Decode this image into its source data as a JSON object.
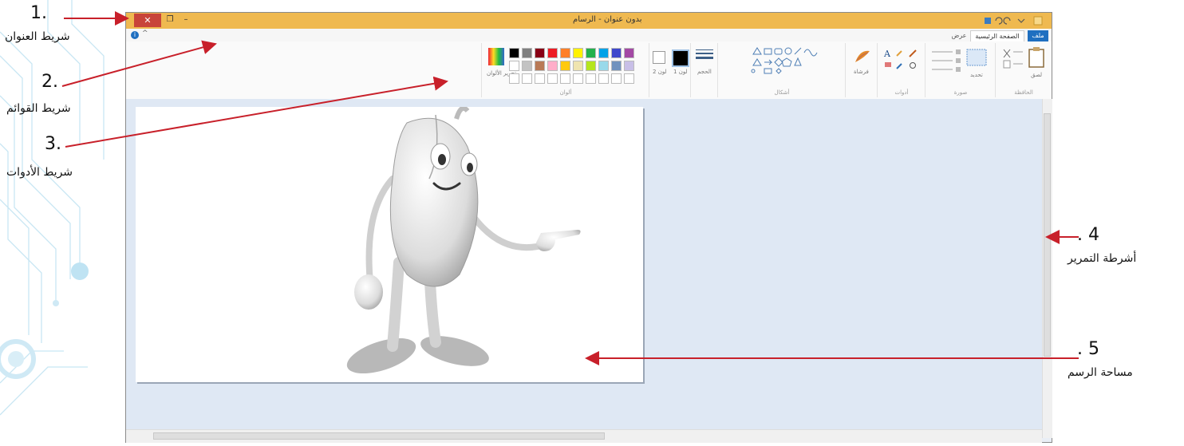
{
  "annotations": [
    {
      "number": "1.",
      "label": "شريط العنوان"
    },
    {
      "number": "2.",
      "label": "شريط القوائم"
    },
    {
      "number": "3.",
      "label": "شريط الأدوات"
    },
    {
      "number": ". 4",
      "label": "أشرطة التمرير"
    },
    {
      "number": ". 5",
      "label": "مساحة الرسم"
    }
  ],
  "window": {
    "title": "بدون عنوان - الرسام",
    "close_glyph": "✕",
    "restore_glyph": "❐",
    "minimize_glyph": "–"
  },
  "menu": {
    "tabs": [
      "ملف",
      "الصفحة الرئيسية",
      "عرض"
    ],
    "help_glyph": "i",
    "collapse_glyph": "^"
  },
  "ribbon": {
    "groups": [
      "الحافظة",
      "صورة",
      "أدوات",
      "أشكال",
      "ألوان"
    ],
    "items": {
      "paste": "لصق",
      "select": "تحديد",
      "brushes": "فرشاة",
      "size": "الحجم",
      "color1": "لون 1",
      "color2": "لون 2",
      "edit_colors": "تحرير الألوان"
    },
    "palette_row1": [
      "#000000",
      "#7f7f7f",
      "#880015",
      "#ed1c24",
      "#ff7f27",
      "#fff200",
      "#22b14c",
      "#00a2e8",
      "#3f48cc",
      "#a349a4"
    ],
    "palette_row2": [
      "#ffffff",
      "#c3c3c3",
      "#b97a57",
      "#ffaec9",
      "#ffc90e",
      "#efe4b0",
      "#b5e61d",
      "#99d9ea",
      "#7092be",
      "#c8bfe7"
    ]
  },
  "colors": {
    "title_bar": "#efb950",
    "close": "#c8443a",
    "arrow": "#c8202a",
    "accent": "#1f6fc0"
  }
}
